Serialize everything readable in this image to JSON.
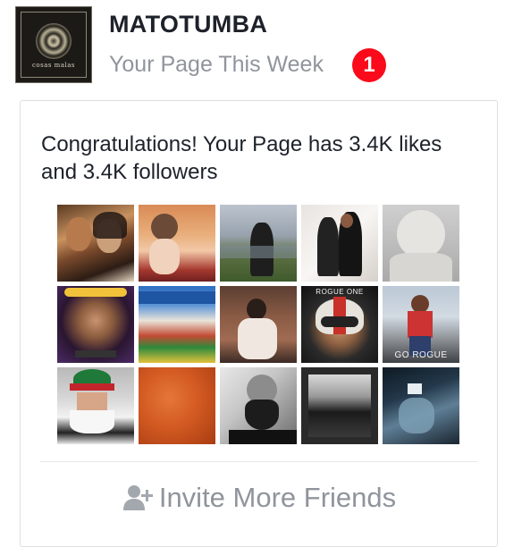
{
  "header": {
    "page_name": "MATOTUMBA",
    "subtitle": "Your Page This Week",
    "notification_count": "1",
    "logo_text": "cosas malas",
    "badge_color": "#fa0a1a"
  },
  "card": {
    "message": "Congratulations! Your Page has 3.4K likes and 3.4K followers",
    "photos": [
      {
        "name": "photo-couple-selfie"
      },
      {
        "name": "photo-toddler-party"
      },
      {
        "name": "photo-man-city-view"
      },
      {
        "name": "photo-couple-formal"
      },
      {
        "name": "photo-knit-hat-back"
      },
      {
        "name": "photo-woman-flower-crown"
      },
      {
        "name": "photo-street-fair"
      },
      {
        "name": "photo-man-guitar"
      },
      {
        "name": "photo-man-pilot-helmet",
        "label": "ROGUE ONE"
      },
      {
        "name": "photo-woman-go-rogue",
        "label": "GO ROGUE"
      },
      {
        "name": "photo-man-elf-costume"
      },
      {
        "name": "photo-orange-texture"
      },
      {
        "name": "photo-bearded-man-bw"
      },
      {
        "name": "photo-night-street-bw"
      },
      {
        "name": "photo-woman-mirror-selfie"
      }
    ],
    "invite_label": "Invite More Friends",
    "invite_icon": "add-friend-icon"
  }
}
